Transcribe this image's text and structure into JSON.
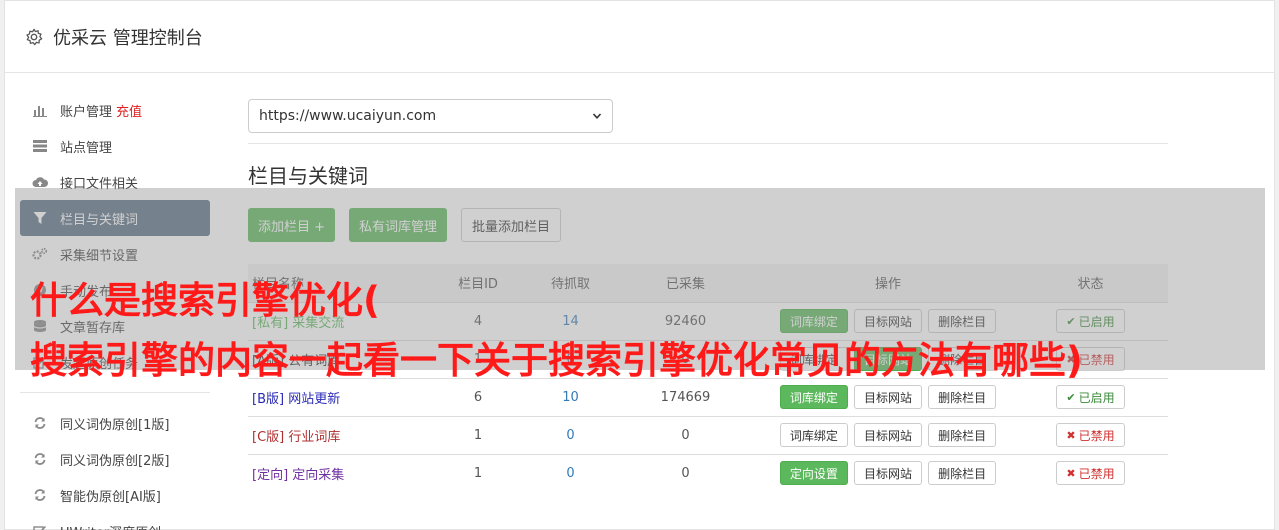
{
  "header": {
    "title": "优采云 管理控制台"
  },
  "sidebar": {
    "items": [
      {
        "label": "账户管理",
        "highlight": "充值",
        "icon": "bar-chart-icon"
      },
      {
        "label": "站点管理",
        "icon": "server-icon"
      },
      {
        "label": "接口文件相关",
        "icon": "cloud-upload-icon"
      },
      {
        "label": "栏目与关键词",
        "icon": "filter-icon",
        "active": true
      },
      {
        "label": "采集细节设置",
        "icon": "gears-icon"
      },
      {
        "label": "手动发布",
        "icon": "send-icon"
      },
      {
        "label": "文章暂存库",
        "icon": "database-icon"
      },
      {
        "label": "发起原创任务",
        "icon": "edit-icon"
      }
    ],
    "items2": [
      {
        "label": "同义词伪原创[1版]",
        "icon": "refresh-icon"
      },
      {
        "label": "同义词伪原创[2版]",
        "icon": "refresh-icon"
      },
      {
        "label": "智能伪原创[AI版]",
        "icon": "refresh-icon"
      },
      {
        "label": "UWriter深度原创",
        "icon": "edit-icon"
      }
    ]
  },
  "site_select": {
    "value": "https://www.ucaiyun.com"
  },
  "section": {
    "title": "栏目与关键词"
  },
  "toolbar": {
    "add_column": "添加栏目 +",
    "private_lib": "私有词库管理",
    "batch_add": "批量添加栏目"
  },
  "table": {
    "headers": {
      "name": "栏目名称",
      "id": "栏目ID",
      "pending": "待抓取",
      "collected": "已采集",
      "actions": "操作",
      "status": "状态"
    },
    "rows": [
      {
        "tag": "[私有]",
        "name": "采集交流",
        "id": "4",
        "pending": "14",
        "collected": "92460",
        "btn1": "词库绑定",
        "btn2": "目标网站",
        "btn3": "删除栏目",
        "status": "已启用"
      },
      {
        "tag": "[A版]",
        "name": "公有词库",
        "id": "1",
        "pending": "0",
        "collected": "0",
        "btn1": "词库绑定",
        "btn2": "目标网站",
        "btn3": "删除栏目",
        "status": "已禁用"
      },
      {
        "tag": "[B版]",
        "name": "网站更新",
        "id": "6",
        "pending": "10",
        "collected": "174669",
        "btn1": "词库绑定",
        "btn2": "目标网站",
        "btn3": "删除栏目",
        "status": "已启用"
      },
      {
        "tag": "[C版]",
        "name": "行业词库",
        "id": "1",
        "pending": "0",
        "collected": "0",
        "btn1": "词库绑定",
        "btn2": "目标网站",
        "btn3": "删除栏目",
        "status": "已禁用"
      },
      {
        "tag": "[定向]",
        "name": "定向采集",
        "id": "1",
        "pending": "0",
        "collected": "0",
        "btn1": "定向设置",
        "btn2": "目标网站",
        "btn3": "删除栏目",
        "status": "已禁用"
      }
    ]
  },
  "overlay": {
    "line1": "什么是搜索引擎优化(",
    "line2": "搜索引擎的内容一起看一下关于搜索引擎优化常见的方法有哪些)"
  },
  "colors": {
    "green": "#5cb85c",
    "active_nav": "#5a6f84",
    "overlay_text": "#ff1a1a"
  }
}
